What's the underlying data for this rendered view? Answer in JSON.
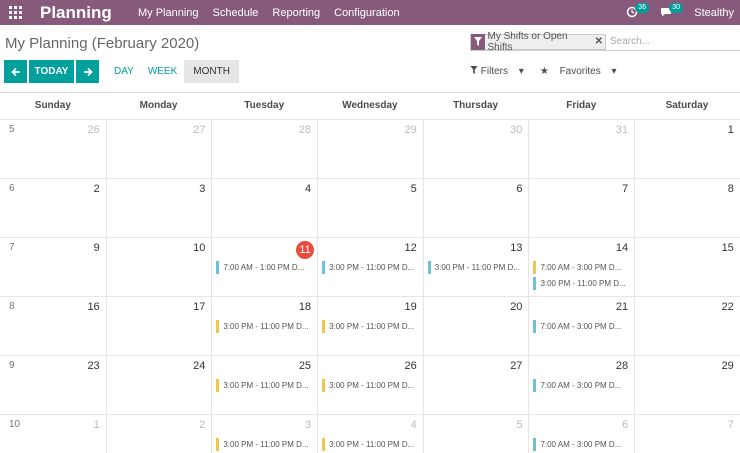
{
  "navbar": {
    "brand": "Planning",
    "menu": [
      "My Planning",
      "Schedule",
      "Reporting",
      "Configuration"
    ],
    "activity_badge": "36",
    "messages_badge": "30",
    "user": "Stealthy"
  },
  "control": {
    "breadcrumb": "My Planning (February 2020)",
    "facet": "My Shifts or Open Shifts",
    "search_placeholder": "Search...",
    "today_label": "TODAY",
    "scales": [
      "DAY",
      "WEEK",
      "MONTH"
    ],
    "filters_label": "Filters",
    "favorites_label": "Favorites"
  },
  "calendar": {
    "weekdays": [
      "Sunday",
      "Monday",
      "Tuesday",
      "Wednesday",
      "Thursday",
      "Friday",
      "Saturday"
    ],
    "weeks": [
      {
        "num": "5",
        "days": [
          {
            "d": "26",
            "other": true,
            "events": []
          },
          {
            "d": "27",
            "other": true,
            "events": []
          },
          {
            "d": "28",
            "other": true,
            "events": []
          },
          {
            "d": "29",
            "other": true,
            "events": []
          },
          {
            "d": "30",
            "other": true,
            "events": []
          },
          {
            "d": "31",
            "other": true,
            "events": []
          },
          {
            "d": "1",
            "events": []
          }
        ]
      },
      {
        "num": "6",
        "days": [
          {
            "d": "2",
            "events": []
          },
          {
            "d": "3",
            "events": []
          },
          {
            "d": "4",
            "events": []
          },
          {
            "d": "5",
            "events": []
          },
          {
            "d": "6",
            "events": []
          },
          {
            "d": "7",
            "events": []
          },
          {
            "d": "8",
            "events": []
          }
        ]
      },
      {
        "num": "7",
        "days": [
          {
            "d": "9",
            "events": []
          },
          {
            "d": "10",
            "events": []
          },
          {
            "d": "11",
            "today": true,
            "events": [
              {
                "t": "7:00 AM - 1:00 PM D...",
                "c": "blue"
              }
            ]
          },
          {
            "d": "12",
            "events": [
              {
                "t": "3:00 PM - 11:00 PM D...",
                "c": "blue"
              }
            ]
          },
          {
            "d": "13",
            "events": [
              {
                "t": "3:00 PM - 11:00 PM D...",
                "c": "blue"
              }
            ]
          },
          {
            "d": "14",
            "events": [
              {
                "t": "7:00 AM - 3:00 PM D...",
                "c": "yellow"
              },
              {
                "t": "3:00 PM - 11:00 PM D...",
                "c": "blue"
              }
            ]
          },
          {
            "d": "15",
            "events": []
          }
        ]
      },
      {
        "num": "8",
        "days": [
          {
            "d": "16",
            "events": []
          },
          {
            "d": "17",
            "events": []
          },
          {
            "d": "18",
            "events": [
              {
                "t": "3:00 PM - 11:00 PM D...",
                "c": "yellow"
              }
            ]
          },
          {
            "d": "19",
            "events": [
              {
                "t": "3:00 PM - 11:00 PM D...",
                "c": "yellow"
              }
            ]
          },
          {
            "d": "20",
            "events": []
          },
          {
            "d": "21",
            "events": [
              {
                "t": "7:00 AM - 3:00 PM D...",
                "c": "blue"
              }
            ]
          },
          {
            "d": "22",
            "events": []
          }
        ]
      },
      {
        "num": "9",
        "days": [
          {
            "d": "23",
            "events": []
          },
          {
            "d": "24",
            "events": []
          },
          {
            "d": "25",
            "events": [
              {
                "t": "3:00 PM - 11:00 PM D...",
                "c": "yellow"
              }
            ]
          },
          {
            "d": "26",
            "events": [
              {
                "t": "3:00 PM - 11:00 PM D...",
                "c": "yellow"
              }
            ]
          },
          {
            "d": "27",
            "events": []
          },
          {
            "d": "28",
            "events": [
              {
                "t": "7:00 AM - 3:00 PM D...",
                "c": "blue"
              }
            ]
          },
          {
            "d": "29",
            "events": []
          }
        ]
      },
      {
        "num": "10",
        "days": [
          {
            "d": "1",
            "other": true,
            "events": []
          },
          {
            "d": "2",
            "other": true,
            "events": []
          },
          {
            "d": "3",
            "other": true,
            "events": [
              {
                "t": "3:00 PM - 11:00 PM D...",
                "c": "yellow"
              }
            ]
          },
          {
            "d": "4",
            "other": true,
            "events": [
              {
                "t": "3:00 PM - 11:00 PM D...",
                "c": "yellow"
              }
            ]
          },
          {
            "d": "5",
            "other": true,
            "events": []
          },
          {
            "d": "6",
            "other": true,
            "events": [
              {
                "t": "7:00 AM - 3:00 PM D...",
                "c": "blue"
              }
            ]
          },
          {
            "d": "7",
            "other": true,
            "events": []
          }
        ]
      }
    ]
  }
}
